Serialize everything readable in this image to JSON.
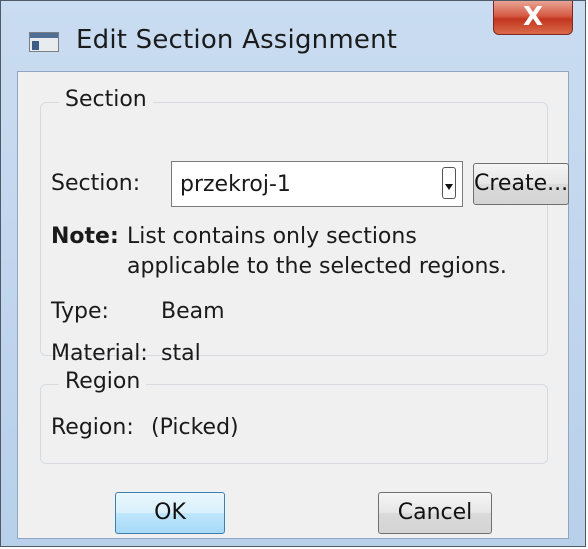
{
  "window": {
    "title": "Edit Section Assignment",
    "close_label": "X"
  },
  "section_group": {
    "label": "Section",
    "section_label": "Section:",
    "section_value": "przekroj-1",
    "create_label": "Create...",
    "note_label": "Note:",
    "note_line1": "List contains only sections",
    "note_line2": "applicable to the selected regions.",
    "type_label": "Type:",
    "type_value": "Beam",
    "material_label": "Material:",
    "material_value": "stal"
  },
  "region_group": {
    "label": "Region",
    "region_label": "Region:",
    "region_value": "(Picked)"
  },
  "buttons": {
    "ok": "OK",
    "cancel": "Cancel"
  }
}
